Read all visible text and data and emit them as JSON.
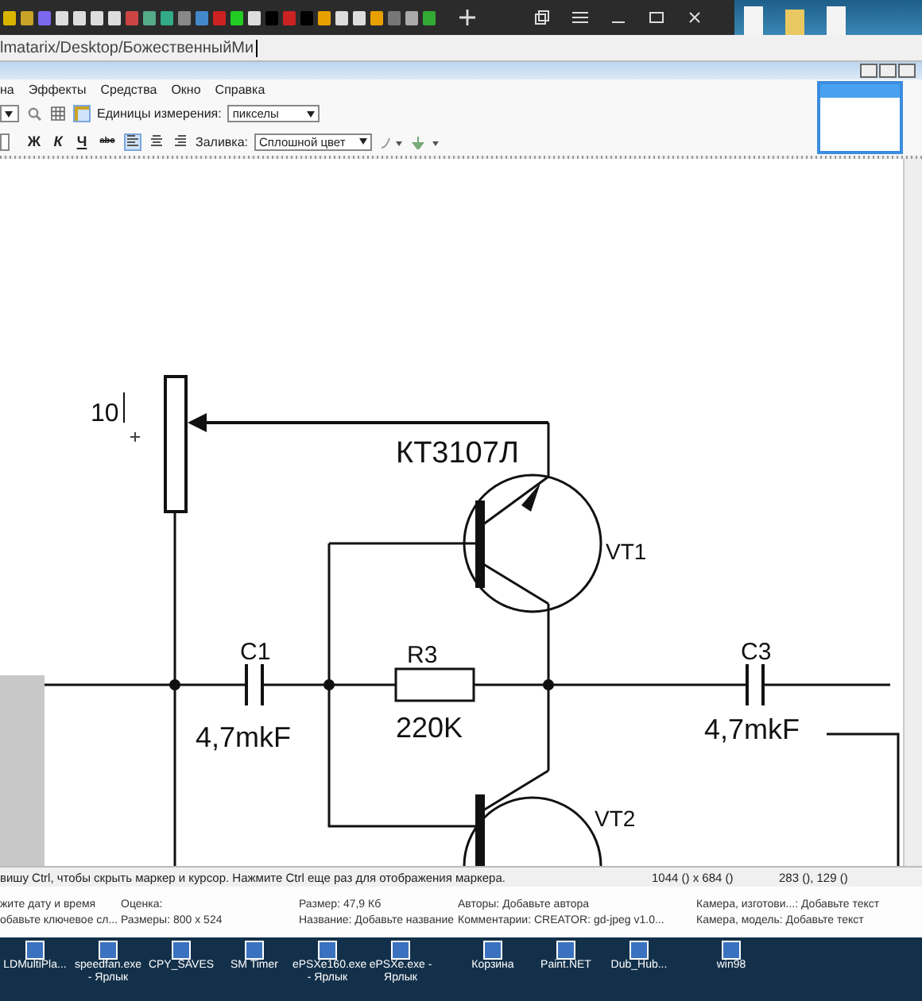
{
  "browser": {
    "address": "lmatarix/Desktop/БожественныйМи"
  },
  "menu": [
    "на",
    "Эффекты",
    "Средства",
    "Окно",
    "Справка"
  ],
  "toolbar": {
    "units_label": "Единицы измерения:",
    "units": "пикселы",
    "bold": "Ж",
    "italic": "К",
    "underline": "Ч",
    "strike": "abc",
    "fill_label": "Заливка:",
    "fill": "Сплошной цвет",
    "align": [
      {
        "kind": "left",
        "selected": true
      },
      {
        "kind": "center",
        "selected": false
      },
      {
        "kind": "right",
        "selected": false
      }
    ],
    "rulers_on": true
  },
  "canvas": {
    "typed_text": "10",
    "transistor_model": "КТ3107Л",
    "vt1": "VT1",
    "c1": "C1",
    "c1_value": "4,7mkF",
    "r3": "R3",
    "r3_value": "220K",
    "c3": "C3",
    "c3_value": "4,7mkF",
    "vt2": "VT2"
  },
  "status_bar": {
    "hint": "вишу Ctrl, чтобы скрыть маркер и курсор. Нажмите Ctrl еще раз для отображения маркера.",
    "image_size": "1044 () x 684 ()",
    "cursor_position": "283 (), 129 ()"
  },
  "details": [
    [
      "жите дату и время",
      "Оценка:",
      "Размер: 47,9 Кб",
      "Авторы: Добавьте автора",
      "Камера, изготови...: Добавьте текст"
    ],
    [
      "обавьте ключевое сл...",
      "Размеры: 800 x 524",
      "Название: Добавьте название",
      "Комментарии: CREATOR: gd-jpeg v1.0...",
      "Камера, модель: Добавьте текст"
    ]
  ],
  "desktop_icons": [
    {
      "label": "LDMultiPla..."
    },
    {
      "label": "speedfan.exe - Ярлык"
    },
    {
      "label": "CPY_SAVES"
    },
    {
      "label": "SM Timer"
    },
    {
      "label": "ePSXe160.exe - Ярлык"
    },
    {
      "label": "ePSXe.exe - Ярлык"
    },
    {
      "label": "Корзина"
    },
    {
      "label": "Paint.NET"
    },
    {
      "label": "Dub_Hub..."
    },
    {
      "label": "win98"
    }
  ]
}
